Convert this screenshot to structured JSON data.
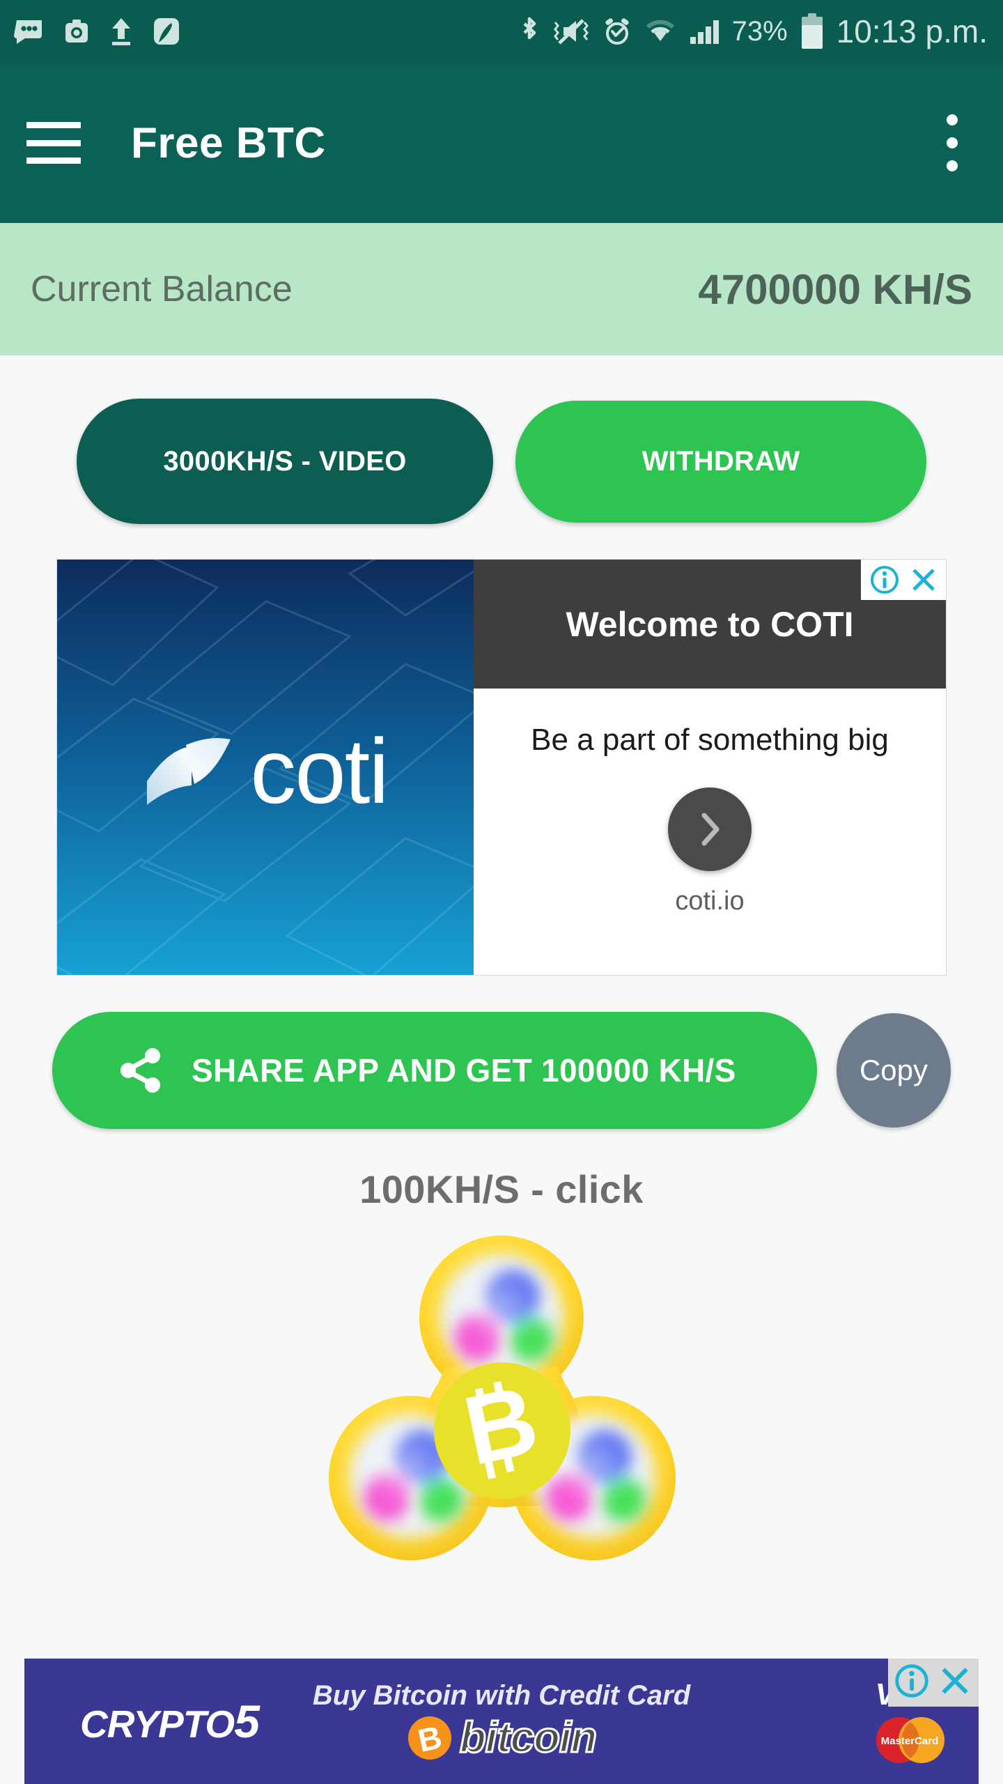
{
  "statusbar": {
    "icons_left": [
      "dots-message-icon",
      "camera-icon",
      "upload-icon",
      "app-notification-icon"
    ],
    "icons_right": [
      "bluetooth-icon",
      "mute-vibrate-icon",
      "alarm-icon",
      "wifi-icon",
      "signal-icon"
    ],
    "battery_percent": "73%",
    "battery_icon": "battery-icon",
    "time": "10:13 p.m."
  },
  "appbar": {
    "menu_icon": "hamburger-menu-icon",
    "title": "Free BTC",
    "overflow_icon": "overflow-menu-icon"
  },
  "balance": {
    "label": "Current Balance",
    "value": "4700000 KH/S"
  },
  "actions": {
    "video_label": "3000KH/S - VIDEO",
    "withdraw_label": "WITHDRAW"
  },
  "ad_top": {
    "brand": "coti",
    "headline": "Welcome to COTI",
    "subtext": "Be a part of something big",
    "url": "coti.io",
    "cta_icon": "chevron-right-icon",
    "info_icon": "ad-info-icon",
    "close_icon": "ad-close-icon"
  },
  "share": {
    "icon": "share-icon",
    "label": "SHARE APP AND GET 100000 KH/S",
    "copy_label": "Copy"
  },
  "spinner": {
    "label": "100KH/S - click",
    "icon": "bitcoin-fidget-spinner"
  },
  "ad_bottom": {
    "brand": "CRYPTO",
    "brand_number": "5",
    "tagline": "Buy Bitcoin with Credit Card",
    "coin_word": "bitcoin",
    "coin_icon": "bitcoin-coin-icon",
    "visa_label": "VISA",
    "mastercard_label": "MasterCard",
    "info_icon": "ad-info-icon",
    "close_icon": "ad-close-icon"
  },
  "colors": {
    "statusbar": "#0a5c51",
    "appbar": "#0c6157",
    "balance_bg": "#b7e7c6",
    "primary_dark": "#0d5e52",
    "accent_green": "#2dc451",
    "copy_gray": "#6e7b8c",
    "page_bg": "#f7f8f8",
    "ad_bottom_bg": "#3b3795",
    "ad_badge_cyan": "#1ab3d4"
  }
}
